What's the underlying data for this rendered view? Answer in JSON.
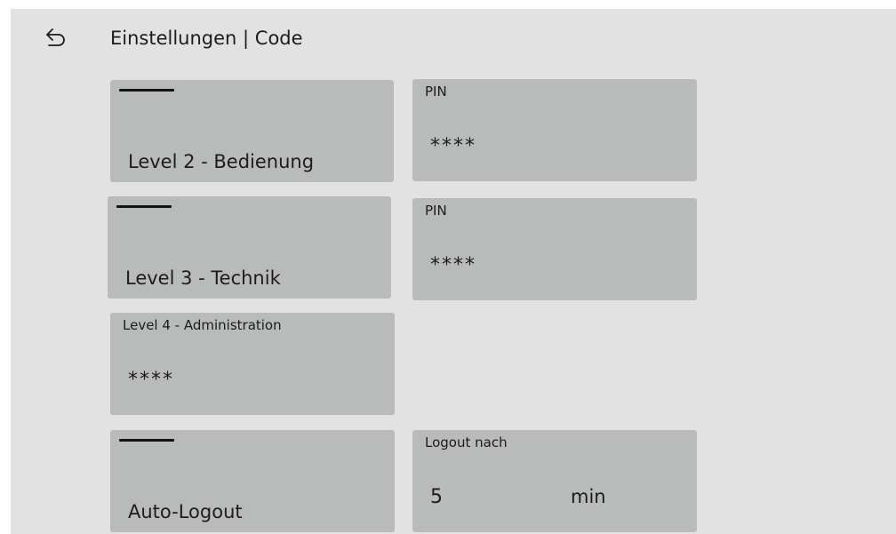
{
  "header": {
    "back_icon": "back-arrow-icon",
    "title": "Einstellungen | Code"
  },
  "level2": {
    "toggle_icon": "toggle-dash-icon",
    "label": "Level 2 - Bedienung",
    "pin_caption": "PIN",
    "pin_value": "****"
  },
  "level3": {
    "toggle_icon": "toggle-dash-icon",
    "label": "Level 3 - Technik",
    "pin_caption": "PIN",
    "pin_value": "****"
  },
  "level4": {
    "caption": "Level 4 - Administration",
    "pin_value": "****"
  },
  "auto_logout": {
    "toggle_icon": "toggle-dash-icon",
    "label": "Auto-Logout",
    "logout_caption": "Logout nach",
    "logout_value": "5",
    "logout_unit": "min"
  },
  "colors": {
    "screen_background": "#e1e2e1",
    "tile_background": "#b9bbba",
    "text": "#1c1c1c"
  }
}
